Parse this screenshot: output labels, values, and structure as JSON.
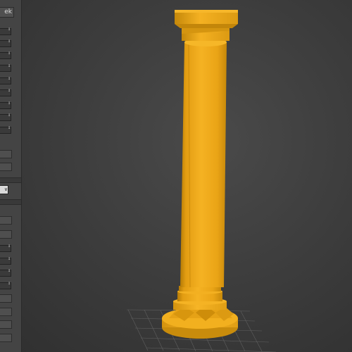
{
  "left_panel": {
    "top_button_label": "ek",
    "dropdown_arrow": "∨",
    "spinner_glyph": "↕"
  },
  "viewport": {
    "background": "#3d3d3d",
    "object_color": "#f0a819",
    "object_shadow": "#c88a0c",
    "grid_color": "#6a6a6a",
    "object": "column"
  },
  "icons": [
    "spinner-icon",
    "dropdown-arrow-icon"
  ]
}
